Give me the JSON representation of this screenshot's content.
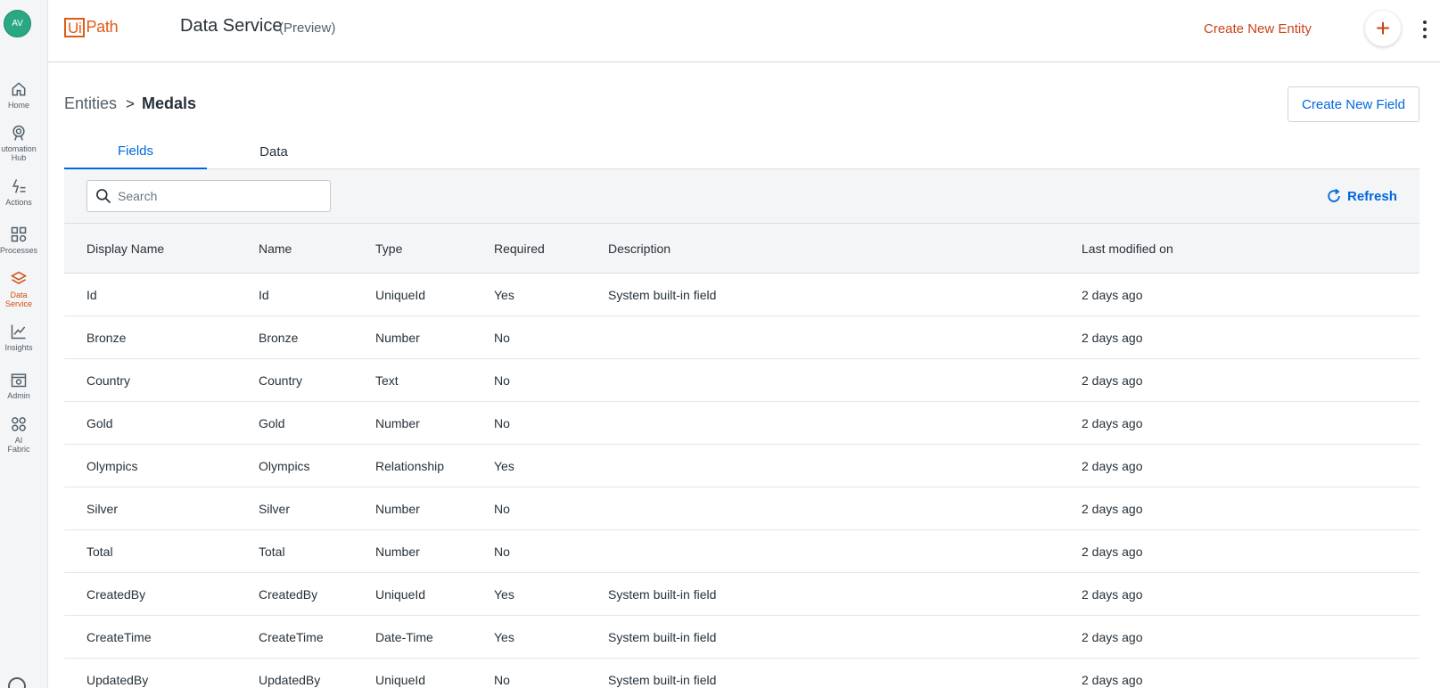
{
  "user": {
    "initials": "AV"
  },
  "nav": {
    "items": [
      {
        "label_lines": [
          "Home"
        ]
      },
      {
        "label_lines": [
          "utomation",
          "Hub"
        ]
      },
      {
        "label_lines": [
          "Actions"
        ]
      },
      {
        "label_lines": [
          "Processes"
        ]
      },
      {
        "label_lines": [
          "Data",
          "Service"
        ]
      },
      {
        "label_lines": [
          "Insights"
        ]
      },
      {
        "label_lines": [
          "Admin"
        ]
      },
      {
        "label_lines": [
          "AI",
          "Fabric"
        ]
      }
    ],
    "active": "Data Service"
  },
  "header": {
    "logo_left": "Ui",
    "logo_right": "Path",
    "product": "Data Service",
    "preview": "(Preview)",
    "create_entity_label": "Create New Entity",
    "plus_label": "+"
  },
  "breadcrumb": {
    "parent": "Entities",
    "separator": ">",
    "current": "Medals"
  },
  "actions": {
    "create_field_label": "Create New Field"
  },
  "tabs": [
    {
      "label": "Fields",
      "active": true
    },
    {
      "label": "Data",
      "active": false
    }
  ],
  "toolbar": {
    "search_placeholder": "Search",
    "search_value": "",
    "refresh_label": "Refresh"
  },
  "table": {
    "columns": [
      "Display Name",
      "Name",
      "Type",
      "Required",
      "Description",
      "Last modified on"
    ],
    "rows": [
      [
        "Id",
        "Id",
        "UniqueId",
        "Yes",
        "System built-in field",
        "2 days ago"
      ],
      [
        "Bronze",
        "Bronze",
        "Number",
        "No",
        "",
        "2 days ago"
      ],
      [
        "Country",
        "Country",
        "Text",
        "No",
        "",
        "2 days ago"
      ],
      [
        "Gold",
        "Gold",
        "Number",
        "No",
        "",
        "2 days ago"
      ],
      [
        "Olympics",
        "Olympics",
        "Relationship",
        "Yes",
        "",
        "2 days ago"
      ],
      [
        "Silver",
        "Silver",
        "Number",
        "No",
        "",
        "2 days ago"
      ],
      [
        "Total",
        "Total",
        "Number",
        "No",
        "",
        "2 days ago"
      ],
      [
        "CreatedBy",
        "CreatedBy",
        "UniqueId",
        "Yes",
        "System built-in field",
        "2 days ago"
      ],
      [
        "CreateTime",
        "CreateTime",
        "Date-Time",
        "Yes",
        "System built-in field",
        "2 days ago"
      ],
      [
        "UpdatedBy",
        "UpdatedBy",
        "UniqueId",
        "No",
        "System built-in field",
        "2 days ago"
      ]
    ]
  },
  "colors": {
    "brand_orange": "#e05a17",
    "accent_blue": "#0067df",
    "active_nav": "#cf4f12",
    "avatar_bg": "#2aa884"
  }
}
